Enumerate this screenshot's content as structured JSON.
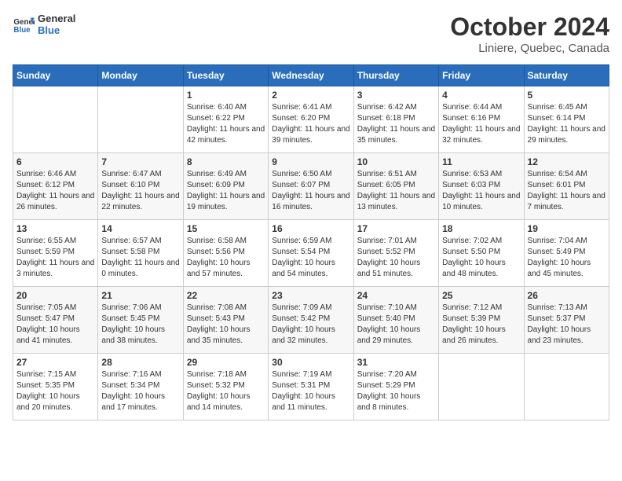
{
  "logo": {
    "line1": "General",
    "line2": "Blue"
  },
  "title": "October 2024",
  "subtitle": "Liniere, Quebec, Canada",
  "weekdays": [
    "Sunday",
    "Monday",
    "Tuesday",
    "Wednesday",
    "Thursday",
    "Friday",
    "Saturday"
  ],
  "weeks": [
    [
      {
        "day": "",
        "sunrise": "",
        "sunset": "",
        "daylight": ""
      },
      {
        "day": "",
        "sunrise": "",
        "sunset": "",
        "daylight": ""
      },
      {
        "day": "1",
        "sunrise": "Sunrise: 6:40 AM",
        "sunset": "Sunset: 6:22 PM",
        "daylight": "Daylight: 11 hours and 42 minutes."
      },
      {
        "day": "2",
        "sunrise": "Sunrise: 6:41 AM",
        "sunset": "Sunset: 6:20 PM",
        "daylight": "Daylight: 11 hours and 39 minutes."
      },
      {
        "day": "3",
        "sunrise": "Sunrise: 6:42 AM",
        "sunset": "Sunset: 6:18 PM",
        "daylight": "Daylight: 11 hours and 35 minutes."
      },
      {
        "day": "4",
        "sunrise": "Sunrise: 6:44 AM",
        "sunset": "Sunset: 6:16 PM",
        "daylight": "Daylight: 11 hours and 32 minutes."
      },
      {
        "day": "5",
        "sunrise": "Sunrise: 6:45 AM",
        "sunset": "Sunset: 6:14 PM",
        "daylight": "Daylight: 11 hours and 29 minutes."
      }
    ],
    [
      {
        "day": "6",
        "sunrise": "Sunrise: 6:46 AM",
        "sunset": "Sunset: 6:12 PM",
        "daylight": "Daylight: 11 hours and 26 minutes."
      },
      {
        "day": "7",
        "sunrise": "Sunrise: 6:47 AM",
        "sunset": "Sunset: 6:10 PM",
        "daylight": "Daylight: 11 hours and 22 minutes."
      },
      {
        "day": "8",
        "sunrise": "Sunrise: 6:49 AM",
        "sunset": "Sunset: 6:09 PM",
        "daylight": "Daylight: 11 hours and 19 minutes."
      },
      {
        "day": "9",
        "sunrise": "Sunrise: 6:50 AM",
        "sunset": "Sunset: 6:07 PM",
        "daylight": "Daylight: 11 hours and 16 minutes."
      },
      {
        "day": "10",
        "sunrise": "Sunrise: 6:51 AM",
        "sunset": "Sunset: 6:05 PM",
        "daylight": "Daylight: 11 hours and 13 minutes."
      },
      {
        "day": "11",
        "sunrise": "Sunrise: 6:53 AM",
        "sunset": "Sunset: 6:03 PM",
        "daylight": "Daylight: 11 hours and 10 minutes."
      },
      {
        "day": "12",
        "sunrise": "Sunrise: 6:54 AM",
        "sunset": "Sunset: 6:01 PM",
        "daylight": "Daylight: 11 hours and 7 minutes."
      }
    ],
    [
      {
        "day": "13",
        "sunrise": "Sunrise: 6:55 AM",
        "sunset": "Sunset: 5:59 PM",
        "daylight": "Daylight: 11 hours and 3 minutes."
      },
      {
        "day": "14",
        "sunrise": "Sunrise: 6:57 AM",
        "sunset": "Sunset: 5:58 PM",
        "daylight": "Daylight: 11 hours and 0 minutes."
      },
      {
        "day": "15",
        "sunrise": "Sunrise: 6:58 AM",
        "sunset": "Sunset: 5:56 PM",
        "daylight": "Daylight: 10 hours and 57 minutes."
      },
      {
        "day": "16",
        "sunrise": "Sunrise: 6:59 AM",
        "sunset": "Sunset: 5:54 PM",
        "daylight": "Daylight: 10 hours and 54 minutes."
      },
      {
        "day": "17",
        "sunrise": "Sunrise: 7:01 AM",
        "sunset": "Sunset: 5:52 PM",
        "daylight": "Daylight: 10 hours and 51 minutes."
      },
      {
        "day": "18",
        "sunrise": "Sunrise: 7:02 AM",
        "sunset": "Sunset: 5:50 PM",
        "daylight": "Daylight: 10 hours and 48 minutes."
      },
      {
        "day": "19",
        "sunrise": "Sunrise: 7:04 AM",
        "sunset": "Sunset: 5:49 PM",
        "daylight": "Daylight: 10 hours and 45 minutes."
      }
    ],
    [
      {
        "day": "20",
        "sunrise": "Sunrise: 7:05 AM",
        "sunset": "Sunset: 5:47 PM",
        "daylight": "Daylight: 10 hours and 41 minutes."
      },
      {
        "day": "21",
        "sunrise": "Sunrise: 7:06 AM",
        "sunset": "Sunset: 5:45 PM",
        "daylight": "Daylight: 10 hours and 38 minutes."
      },
      {
        "day": "22",
        "sunrise": "Sunrise: 7:08 AM",
        "sunset": "Sunset: 5:43 PM",
        "daylight": "Daylight: 10 hours and 35 minutes."
      },
      {
        "day": "23",
        "sunrise": "Sunrise: 7:09 AM",
        "sunset": "Sunset: 5:42 PM",
        "daylight": "Daylight: 10 hours and 32 minutes."
      },
      {
        "day": "24",
        "sunrise": "Sunrise: 7:10 AM",
        "sunset": "Sunset: 5:40 PM",
        "daylight": "Daylight: 10 hours and 29 minutes."
      },
      {
        "day": "25",
        "sunrise": "Sunrise: 7:12 AM",
        "sunset": "Sunset: 5:39 PM",
        "daylight": "Daylight: 10 hours and 26 minutes."
      },
      {
        "day": "26",
        "sunrise": "Sunrise: 7:13 AM",
        "sunset": "Sunset: 5:37 PM",
        "daylight": "Daylight: 10 hours and 23 minutes."
      }
    ],
    [
      {
        "day": "27",
        "sunrise": "Sunrise: 7:15 AM",
        "sunset": "Sunset: 5:35 PM",
        "daylight": "Daylight: 10 hours and 20 minutes."
      },
      {
        "day": "28",
        "sunrise": "Sunrise: 7:16 AM",
        "sunset": "Sunset: 5:34 PM",
        "daylight": "Daylight: 10 hours and 17 minutes."
      },
      {
        "day": "29",
        "sunrise": "Sunrise: 7:18 AM",
        "sunset": "Sunset: 5:32 PM",
        "daylight": "Daylight: 10 hours and 14 minutes."
      },
      {
        "day": "30",
        "sunrise": "Sunrise: 7:19 AM",
        "sunset": "Sunset: 5:31 PM",
        "daylight": "Daylight: 10 hours and 11 minutes."
      },
      {
        "day": "31",
        "sunrise": "Sunrise: 7:20 AM",
        "sunset": "Sunset: 5:29 PM",
        "daylight": "Daylight: 10 hours and 8 minutes."
      },
      {
        "day": "",
        "sunrise": "",
        "sunset": "",
        "daylight": ""
      },
      {
        "day": "",
        "sunrise": "",
        "sunset": "",
        "daylight": ""
      }
    ]
  ]
}
